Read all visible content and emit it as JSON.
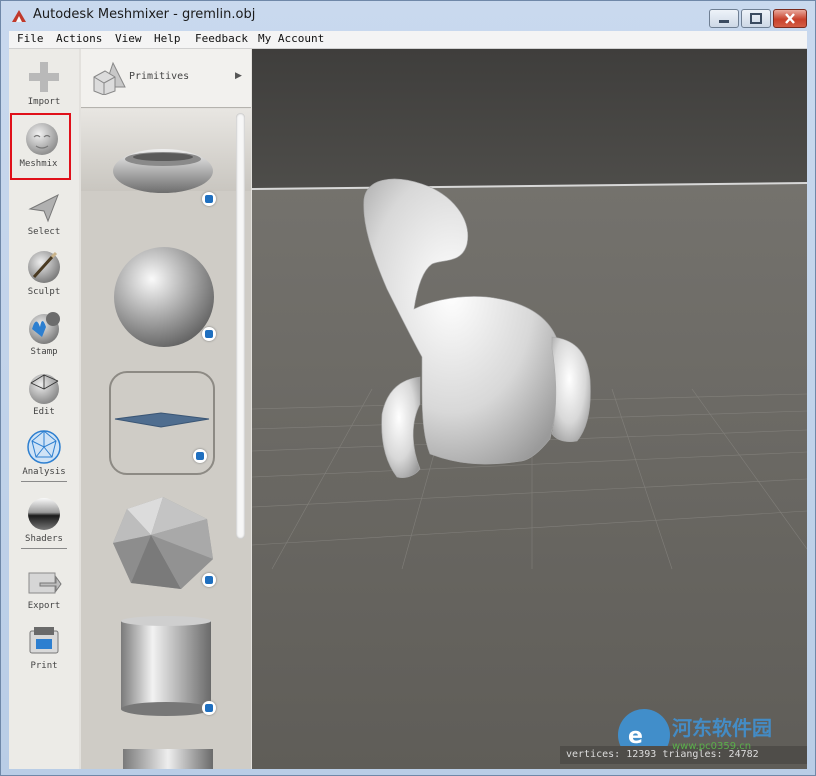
{
  "window": {
    "title": "Autodesk Meshmixer - gremlin.obj"
  },
  "menu": [
    "File",
    "Actions",
    "View",
    "Help",
    "Feedback",
    "My Account"
  ],
  "tools": [
    {
      "label": "Import",
      "icon": "plus-icon"
    },
    {
      "label": "Meshmix",
      "icon": "meshmix-face-icon",
      "selected": true
    },
    {
      "label": "Select",
      "icon": "arrow-pointer-icon"
    },
    {
      "label": "Sculpt",
      "icon": "brush-sphere-icon"
    },
    {
      "label": "Stamp",
      "icon": "stamp-sphere-icon"
    },
    {
      "label": "Edit",
      "icon": "wire-sphere-icon"
    },
    {
      "label": "Analysis",
      "icon": "geodesic-sphere-icon"
    },
    {
      "label": "Shaders",
      "icon": "chrome-sphere-icon"
    },
    {
      "label": "Export",
      "icon": "export-folder-icon"
    },
    {
      "label": "Print",
      "icon": "printer-icon"
    }
  ],
  "submenu": {
    "label": "Primitives",
    "arrow": "▶"
  },
  "primitives": [
    "torus",
    "sphere",
    "plane",
    "icosahedron",
    "cylinder"
  ],
  "status": {
    "text": "vertices: 12393 triangles: 24782"
  },
  "watermark": {
    "text": "河东软件园",
    "url": "www.pc0359.cn"
  },
  "colors": {
    "selection_highlight": "#e0101a",
    "viewport_background": "#5e5c57"
  }
}
